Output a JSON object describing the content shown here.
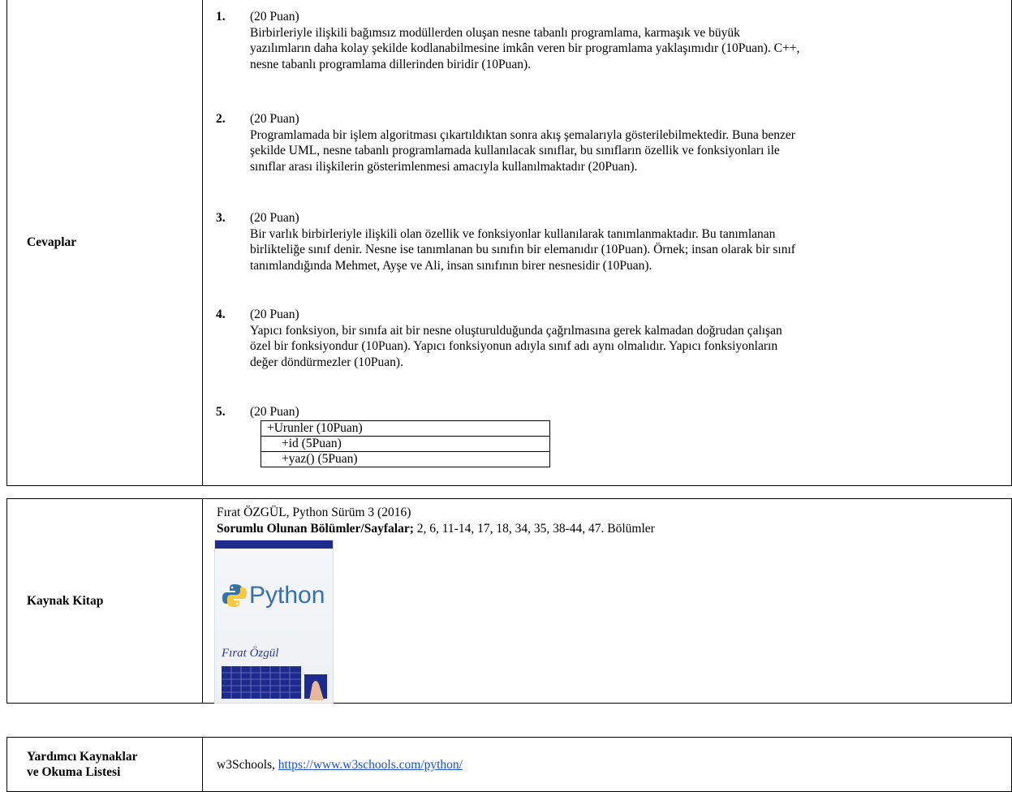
{
  "answers": {
    "label": "Cevaplar",
    "items": [
      {
        "num": "1.",
        "points": "(20 Puan)",
        "lines": [
          "Birbirleriyle ilişkili bağımsız modüllerden oluşan nesne tabanlı programlama, karmaşık ve büyük",
          "yazılımların daha kolay şekilde kodlanabilmesine imkân veren bir programlama yaklaşımıdır (10Puan). C++,",
          "nesne tabanlı programlama dillerinden biridir (10Puan)."
        ]
      },
      {
        "num": "2.",
        "points": "(20 Puan)",
        "lines": [
          "Programlamada bir işlem algoritması çıkartıldıktan sonra akış şemalarıyla gösterilebilmektedir. Buna benzer",
          "şekilde UML, nesne tabanlı programlamada kullanılacak sınıflar, bu sınıfların özellik ve fonksiyonları ile",
          "sınıflar arası ilişkilerin gösterimlenmesi amacıyla kullanılmaktadır (20Puan)."
        ]
      },
      {
        "num": "3.",
        "points": "(20 Puan)",
        "lines": [
          "Bir varlık birbirleriyle ilişkili olan özellik ve fonksiyonlar kullanılarak tanımlanmaktadır. Bu tanımlanan",
          "birlikteliğe sınıf denir. Nesne ise tanımlanan bu sınıfın bir elemanıdır (10Puan). Örnek; insan olarak bir sınıf",
          "tanımlandığında Mehmet, Ayşe ve Ali, insan sınıfının birer nesnesidir (10Puan)."
        ]
      },
      {
        "num": "4.",
        "points": "(20 Puan)",
        "lines": [
          "Yapıcı fonksiyon, bir sınıfa ait bir nesne oluşturulduğunda çağrılmasına gerek kalmadan doğrudan çalışan",
          "özel bir fonksiyondur (10Puan). Yapıcı fonksiyonun adıyla sınıf adı aynı olmalıdır. Yapıcı fonksiyonların",
          "değer döndürmezler (10Puan)."
        ]
      },
      {
        "num": "5.",
        "points": "(20 Puan)",
        "lines": []
      }
    ],
    "uml": [
      "+Urunler (10Puan)",
      "+id (5Puan)",
      "+yaz() (5Puan)"
    ]
  },
  "book": {
    "label": "Kaynak Kitap",
    "citation": "Fırat ÖZGÜL, Python Sürüm 3 (2016)",
    "sections_label": "Sorumlu Olunan Bölümler/Sayfalar;",
    "sections_value": " 2, 6, 11-14, 17, 18, 34, 35, 38-44, 47. Bölümler",
    "cover": {
      "logo_text": "Python",
      "author": "Fırat Özgül"
    }
  },
  "extra": {
    "label_line1": "Yardımcı Kaynaklar",
    "label_line2": "ve Okuma Listesi",
    "text": "w3Schools, ",
    "link": "https://www.w3schools.com/python/"
  }
}
